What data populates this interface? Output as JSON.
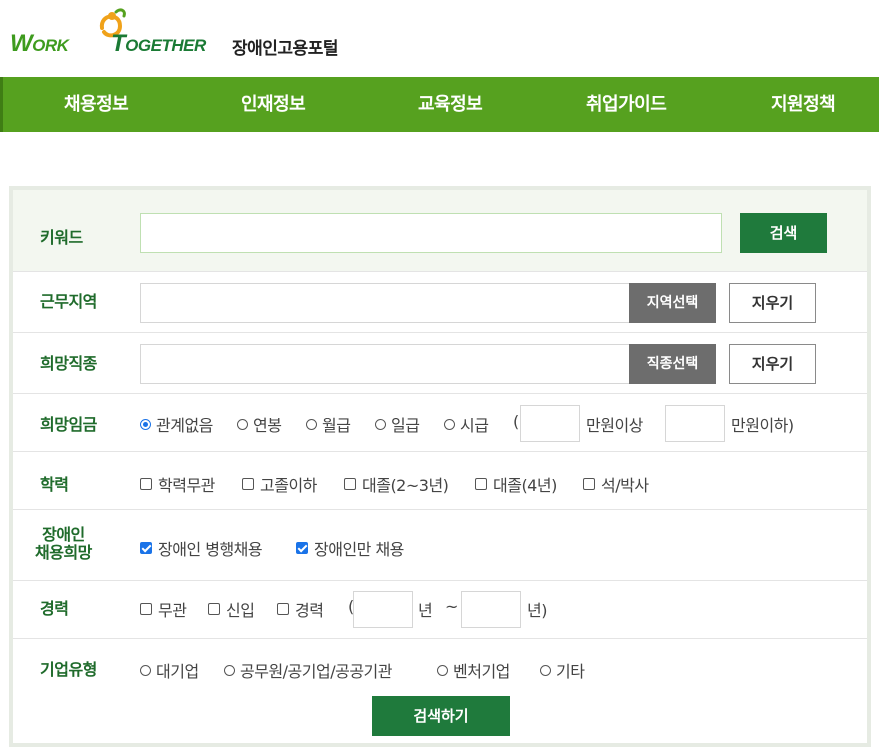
{
  "header": {
    "logo_work_first": "W",
    "logo_work_rest": "ORK",
    "logo_together_first": "T",
    "logo_together_rest": "OGETHER",
    "logo_subtitle": "장애인고용포털",
    "brand_colors": {
      "green": "#3e9b1e",
      "dark_green": "#1a7a34",
      "orange": "#f0a21a"
    }
  },
  "nav": {
    "items": [
      "채용정보",
      "인재정보",
      "교육정보",
      "취업가이드",
      "지원정책"
    ],
    "background": "#56a11f"
  },
  "form": {
    "keyword": {
      "label": "키워드",
      "value": "",
      "button": "검색"
    },
    "region": {
      "label": "근무지역",
      "value": "",
      "select_button": "지역선택",
      "clear_button": "지우기"
    },
    "job": {
      "label": "희망직종",
      "value": "",
      "select_button": "직종선택",
      "clear_button": "지우기"
    },
    "wage": {
      "label": "희망임금",
      "options": [
        "관계없음",
        "연봉",
        "월급",
        "일급",
        "시급"
      ],
      "selected": "관계없음",
      "open_paren": "(",
      "min_value": "",
      "min_suffix": "만원이상",
      "max_value": "",
      "max_suffix": "만원이하)"
    },
    "education": {
      "label": "학력",
      "options": [
        "학력무관",
        "고졸이하",
        "대졸(2~3년)",
        "대졸(4년)",
        "석/박사"
      ],
      "checked": []
    },
    "disability": {
      "label_line1": "장애인",
      "label_line2": "채용희망",
      "options": [
        "장애인 병행채용",
        "장애인만 채용"
      ],
      "checked": [
        "장애인 병행채용",
        "장애인만 채용"
      ]
    },
    "career": {
      "label": "경력",
      "options": [
        "무관",
        "신입",
        "경력"
      ],
      "checked": [],
      "open_paren": "(",
      "from_value": "",
      "year_label": "년",
      "tilde": "~",
      "to_value": "",
      "year_close": "년)"
    },
    "company": {
      "label": "기업유형",
      "options": [
        "대기업",
        "공무원/공기업/공공기관",
        "벤처기업",
        "기타"
      ],
      "selected": ""
    },
    "submit_button": "검색하기"
  }
}
